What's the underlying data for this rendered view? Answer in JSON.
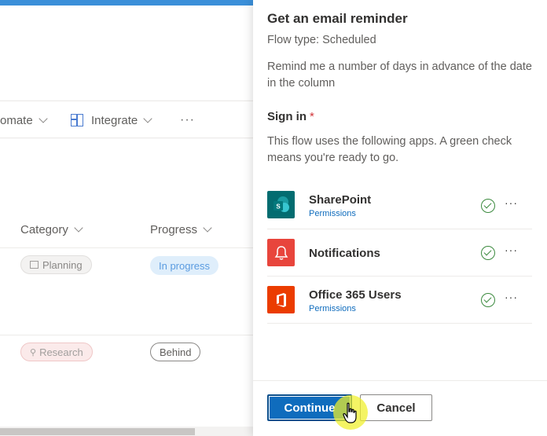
{
  "background": {
    "command_bar": {
      "automate_label": "omate",
      "integrate_label": "Integrate",
      "more": "···"
    },
    "columns": {
      "category": "Category",
      "progress": "Progress"
    },
    "rows": [
      {
        "category": "Planning",
        "progress": "In progress"
      },
      {
        "category": "Research",
        "progress": "Behind"
      }
    ]
  },
  "panel": {
    "title": "Get an email reminder",
    "flow_type": "Flow type: Scheduled",
    "description": "Remind me a number of days in advance of the date in the column",
    "sign_in_label": "Sign in",
    "required_marker": "*",
    "apps_description": "This flow uses the following apps. A green check means you're ready to go.",
    "apps": [
      {
        "name": "SharePoint",
        "permissions": "Permissions",
        "icon": "sharepoint-icon",
        "color": "#036c70"
      },
      {
        "name": "Notifications",
        "permissions": "",
        "icon": "notifications-bell-icon",
        "color": "#e8453c"
      },
      {
        "name": "Office 365 Users",
        "permissions": "Permissions",
        "icon": "office365-icon",
        "color": "#eb3c00"
      }
    ],
    "more": "···",
    "continue_label": "Continue",
    "cancel_label": "Cancel"
  },
  "colors": {
    "accent": "#0f6cbd",
    "check": "#3b8a3e",
    "top_bar": "#3b8fd9"
  }
}
